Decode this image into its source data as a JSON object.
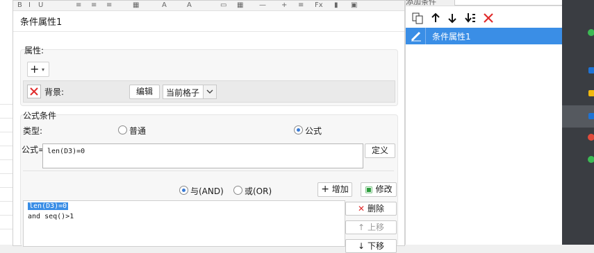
{
  "dialog": {
    "title": "条件属性1",
    "properties": {
      "label": "属性:",
      "add_icon": "plus-icon",
      "background_label": "背景:",
      "edit_label": "编辑",
      "scope_value": "当前格子"
    },
    "formula_condition": {
      "section_label": "公式条件",
      "type_label": "类型:",
      "type_options": [
        "普通",
        "公式"
      ],
      "type_selected": "公式",
      "formula_label": "公式=",
      "formula_value": "len(D3)=0",
      "define_label": "定义"
    },
    "logic": {
      "options": [
        "与(AND)",
        "或(OR)"
      ],
      "selected": "与(AND)",
      "add_label": "增加",
      "modify_label": "修改"
    },
    "conditions_list": [
      "len(D3)=0",
      "and seq()>1"
    ],
    "list_actions": {
      "delete_label": "删除",
      "move_up_label": "上移",
      "move_down_label": "下移"
    }
  },
  "right_panel": {
    "header_text": "添加条件",
    "toolbar_icons": [
      "copy-icon",
      "arrow-up-icon",
      "arrow-down-icon",
      "move-bottom-icon",
      "delete-icon"
    ],
    "items": [
      "条件属性1"
    ],
    "selected_item": "条件属性1"
  },
  "colors": {
    "accent": "#3a8ee6",
    "delete_red": "#e02b2b",
    "taskbar": "#3a3d42"
  }
}
